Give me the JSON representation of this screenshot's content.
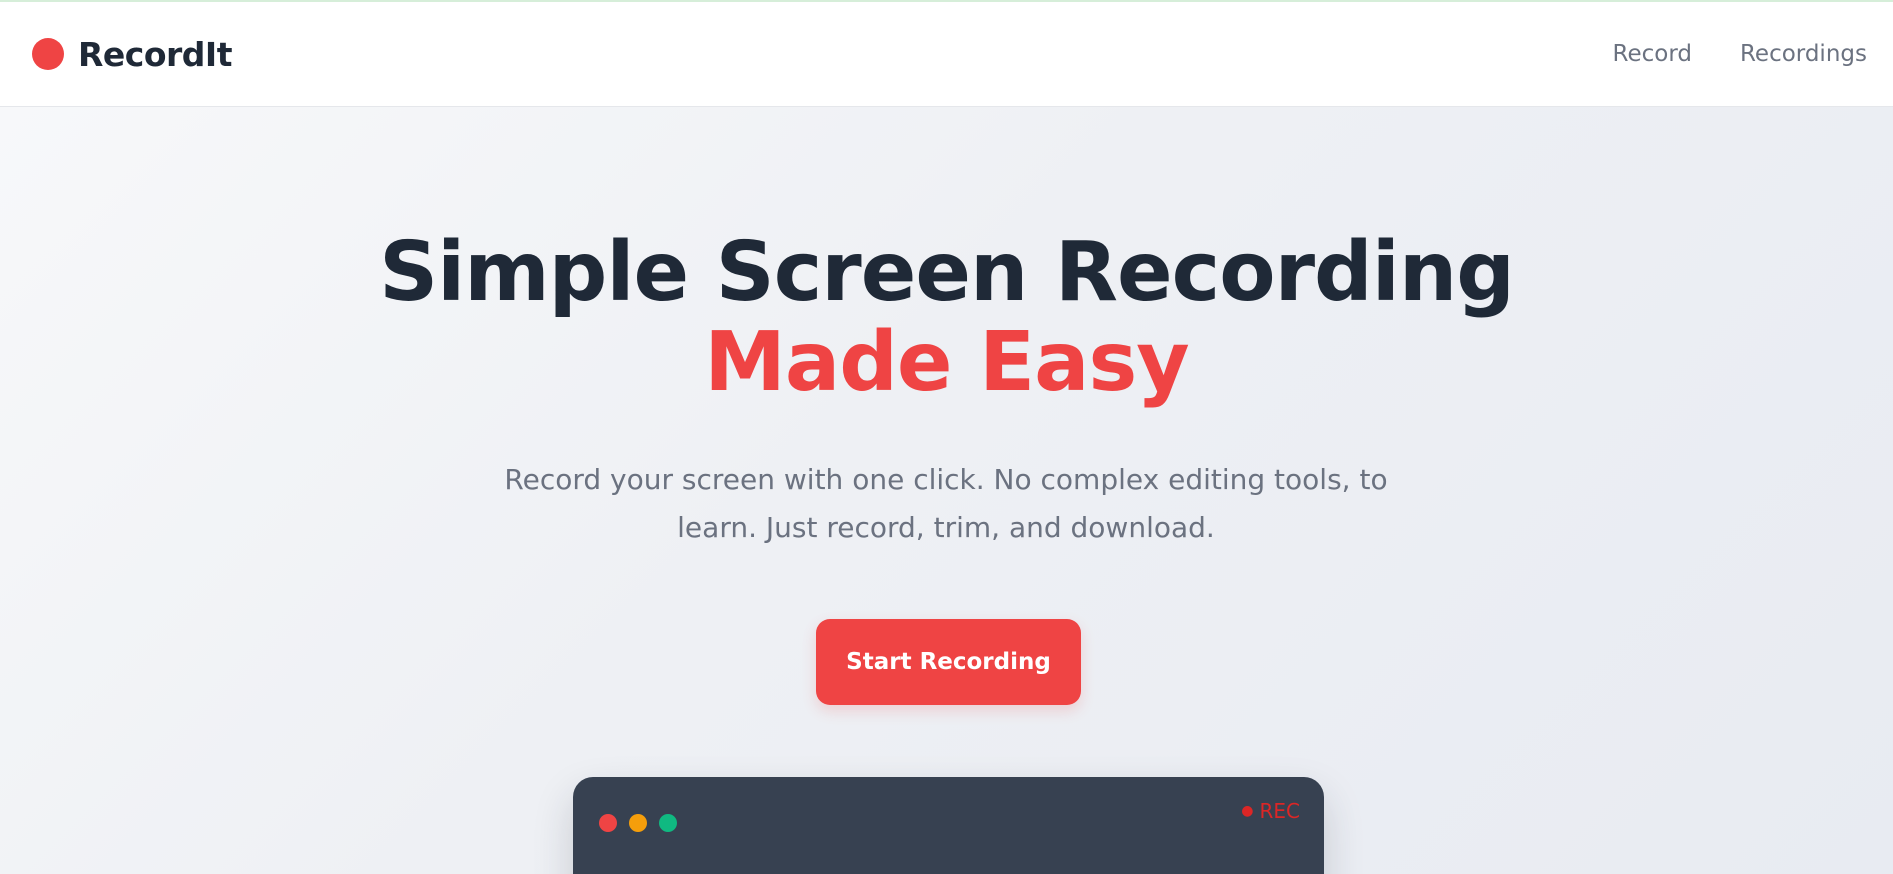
{
  "header": {
    "brand": "RecordIt",
    "nav": [
      {
        "label": "Record"
      },
      {
        "label": "Recordings"
      }
    ]
  },
  "hero": {
    "title_line1": "Simple Screen Recording",
    "title_line2": "Made Easy",
    "subtitle": "Record your screen with one click. No complex editing tools, to learn. Just record, trim, and download.",
    "cta_label": "Start Recording"
  },
  "preview": {
    "rec_dot": "●",
    "rec_label": "REC"
  },
  "colors": {
    "accent": "#ef4444",
    "heading": "#1f2937",
    "muted": "#6b7280",
    "window": "#374151",
    "dot_yellow": "#f59e0b",
    "dot_green": "#10b981"
  },
  "icons": {
    "brand": "record-dot-icon",
    "window_controls": [
      "close-dot-icon",
      "minimize-dot-icon",
      "maximize-dot-icon"
    ],
    "rec": "recording-dot-icon"
  }
}
